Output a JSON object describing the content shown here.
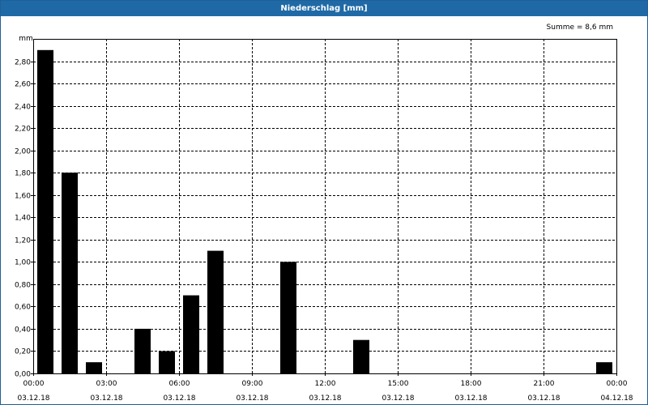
{
  "window": {
    "title": "Niederschlag [mm]"
  },
  "colors": {
    "title_bar": "#1f6aa6",
    "bars": "#000000",
    "grid": "#000000"
  },
  "chart_data": {
    "type": "bar",
    "title": "Niederschlag [mm]",
    "ylabel": "mm",
    "xlabel": "",
    "sum_label": "Summe = 8,6 mm",
    "ylim": [
      0,
      3.0
    ],
    "y_ticks": [
      0.0,
      0.2,
      0.4,
      0.6,
      0.8,
      1.0,
      1.2,
      1.4,
      1.6,
      1.8,
      2.0,
      2.2,
      2.4,
      2.6,
      2.8
    ],
    "y_tick_labels": [
      "0,00",
      "0,20",
      "0,40",
      "0,60",
      "0,80",
      "1,00",
      "1,20",
      "1,40",
      "1,60",
      "1,80",
      "2,00",
      "2,20",
      "2,40",
      "2,60",
      "2,80"
    ],
    "x_range_hours": [
      0,
      24
    ],
    "x_ticks": [
      {
        "hour": 0,
        "time": "00:00",
        "date": "03.12.18"
      },
      {
        "hour": 3,
        "time": "03:00",
        "date": "03.12.18"
      },
      {
        "hour": 6,
        "time": "06:00",
        "date": "03.12.18"
      },
      {
        "hour": 9,
        "time": "09:00",
        "date": "03.12.18"
      },
      {
        "hour": 12,
        "time": "12:00",
        "date": "03.12.18"
      },
      {
        "hour": 15,
        "time": "15:00",
        "date": "03.12.18"
      },
      {
        "hour": 18,
        "time": "18:00",
        "date": "03.12.18"
      },
      {
        "hour": 21,
        "time": "21:00",
        "date": "03.12.18"
      },
      {
        "hour": 24,
        "time": "00:00",
        "date": "04.12.18"
      }
    ],
    "categories": [
      "00:00",
      "01:00",
      "02:00",
      "03:00",
      "04:00",
      "05:00",
      "06:00",
      "07:00",
      "08:00",
      "09:00",
      "10:00",
      "11:00",
      "12:00",
      "13:00",
      "14:00",
      "15:00",
      "16:00",
      "17:00",
      "18:00",
      "19:00",
      "20:00",
      "21:00",
      "22:00",
      "23:00"
    ],
    "values": [
      2.9,
      1.8,
      0.1,
      0.0,
      0.4,
      0.2,
      0.7,
      1.1,
      0.0,
      0.0,
      1.0,
      0.0,
      0.0,
      0.3,
      0.0,
      0.0,
      0.0,
      0.0,
      0.0,
      0.0,
      0.0,
      0.0,
      0.0,
      0.1
    ],
    "grid": true
  }
}
